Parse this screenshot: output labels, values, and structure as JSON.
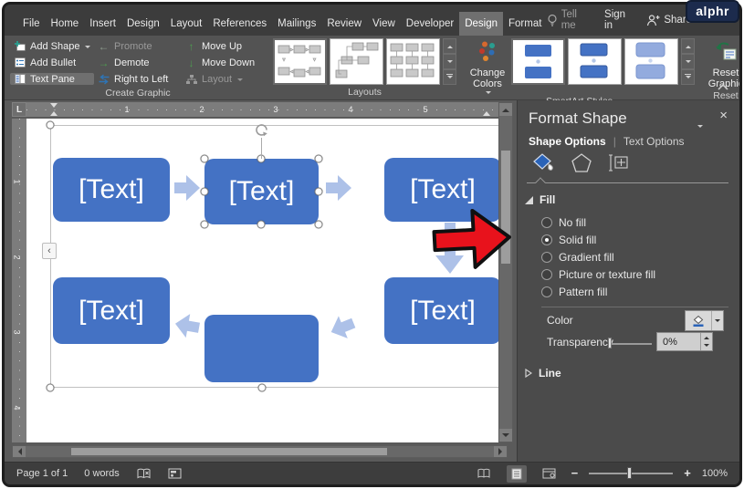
{
  "brand": {
    "logo": "alphr"
  },
  "menu": {
    "tabs": [
      "File",
      "Home",
      "Insert",
      "Design",
      "Layout",
      "References",
      "Mailings",
      "Review",
      "View",
      "Developer",
      "Design",
      "Format"
    ],
    "active_index": 10,
    "tell_me": "Tell me",
    "sign_in": "Sign in",
    "share": "Share"
  },
  "ribbon": {
    "create_graphic": {
      "label": "Create Graphic",
      "add_shape": "Add Shape",
      "add_bullet": "Add Bullet",
      "text_pane": "Text Pane",
      "promote": "Promote",
      "demote": "Demote",
      "right_to_left": "Right to Left",
      "move_up": "Move Up",
      "move_down": "Move Down",
      "layout": "Layout"
    },
    "layouts_label": "Layouts",
    "change_colors": "Change Colors",
    "smartart_styles_label": "SmartArt Styles",
    "reset_button": "Reset Graphic",
    "reset_label": "Reset"
  },
  "document": {
    "ruler_h": [
      "1",
      "2",
      "3",
      "4",
      "5"
    ],
    "ruler_v": [
      "1",
      "2",
      "3",
      "4"
    ],
    "smartart": {
      "placeholder": "[Text]"
    }
  },
  "panel": {
    "title": "Format Shape",
    "tab_shape": "Shape Options",
    "tab_text": "Text Options",
    "fill": {
      "header": "Fill",
      "options": [
        "No fill",
        "Solid fill",
        "Gradient fill",
        "Picture or texture fill",
        "Pattern fill"
      ],
      "selected_index": 1
    },
    "color_label": "Color",
    "transparency_label": "Transparency",
    "transparency_value": "0%",
    "line_header": "Line"
  },
  "status": {
    "page": "Page 1 of 1",
    "words": "0 words",
    "zoom": "100%"
  },
  "colors": {
    "shape_blue": "#4472C4",
    "arrow_blue": "#ADC1E8",
    "annotation_red": "#E8121C",
    "green_arrow": "#4E9A50",
    "blue_arrow_icon": "#2E74B5"
  }
}
